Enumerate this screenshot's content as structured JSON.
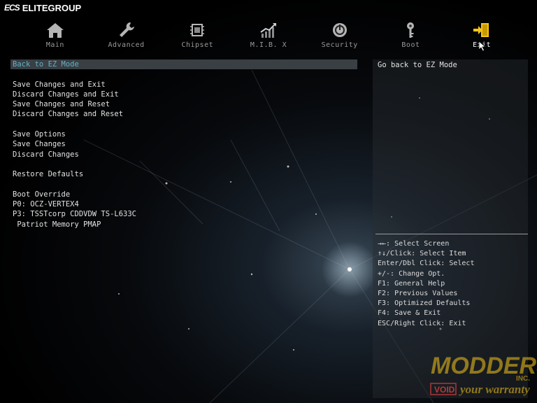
{
  "brand": {
    "mark": "ECS",
    "name": "ELITEGROUP"
  },
  "nav": {
    "tabs": [
      {
        "label": "Main",
        "icon": "home-icon"
      },
      {
        "label": "Advanced",
        "icon": "wrench-icon"
      },
      {
        "label": "Chipset",
        "icon": "chip-icon"
      },
      {
        "label": "M.I.B. X",
        "icon": "performance-chart-icon"
      },
      {
        "label": "Security",
        "icon": "power-shield-icon"
      },
      {
        "label": "Boot",
        "icon": "key-icon"
      },
      {
        "label": "Exit",
        "icon": "exit-door-icon"
      }
    ],
    "active": "Exit"
  },
  "menu": {
    "back_to_ez": "Back to EZ Mode",
    "save_exit": "Save Changes and Exit",
    "discard_exit": "Discard Changes and Exit",
    "save_reset": "Save Changes and Reset",
    "discard_reset": "Discard Changes and Reset",
    "save_options": "Save Options",
    "save_changes": "Save Changes",
    "discard_changes": "Discard Changes",
    "restore_defaults": "Restore Defaults",
    "boot_override": "Boot Override",
    "boot_p0": "P0: OCZ-VERTEX4",
    "boot_p3": "P3: TSSTcorp CDDVDW TS-L633C",
    "boot_patriot": " Patriot Memory PMAP"
  },
  "help": {
    "description": "Go back to EZ Mode",
    "keys": [
      "→←: Select Screen",
      "↑↓/Click: Select Item",
      "Enter/Dbl Click: Select",
      "+/-: Change Opt.",
      "F1: General Help",
      "F2: Previous Values",
      "F3: Optimized Defaults",
      "F4: Save & Exit",
      "ESC/Right Click: Exit"
    ]
  },
  "watermark": {
    "line1": "MODDERS",
    "line2": "INC.",
    "line3": "VOID",
    "line4": "your warranty"
  },
  "colors": {
    "accent": "#f5c518",
    "selected_text": "#5fb3c8",
    "selected_bg": "#3a3f44"
  }
}
